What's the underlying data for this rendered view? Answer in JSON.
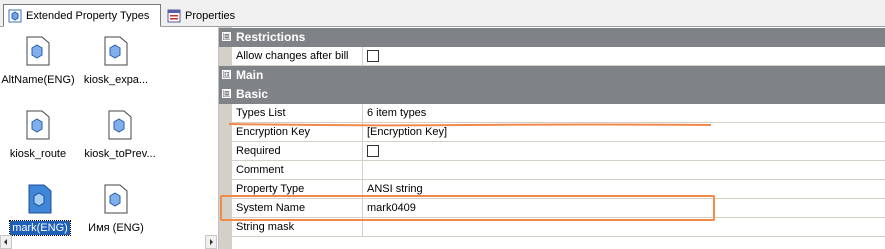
{
  "tabs": [
    {
      "label": "Extended Property Types",
      "icon": "property-type-icon",
      "active": true
    },
    {
      "label": "Properties",
      "icon": "properties-icon",
      "active": false
    }
  ],
  "left_items": [
    {
      "label": "AltName(ENG)",
      "icon": "hexagon-doc-icon"
    },
    {
      "label": "kiosk_expa...",
      "icon": "hexagon-doc-icon"
    },
    {
      "label": "kiosk_route",
      "icon": "hexagon-doc-icon"
    },
    {
      "label": "kiosk_toPrev...",
      "icon": "hexagon-doc-icon"
    },
    {
      "label": "mark(ENG)",
      "icon": "hexagon-doc-icon",
      "selected": true
    },
    {
      "label": "Имя (ENG)",
      "icon": "hexagon-doc-icon"
    }
  ],
  "grid": {
    "categories": {
      "restrictions": {
        "label": "Restrictions",
        "toggle": "⊟"
      },
      "main": {
        "label": "Main",
        "toggle": "⊞"
      },
      "basic": {
        "label": "Basic",
        "toggle": "⊟"
      }
    },
    "rows": {
      "allow_changes": {
        "name": "Allow changes after bill",
        "value": "",
        "checkbox": true
      },
      "types_list": {
        "name": "Types List",
        "value": "6 item types"
      },
      "encryption_key": {
        "name": "Encryption Key",
        "value": "[Encryption Key]"
      },
      "required": {
        "name": "Required",
        "value": "",
        "checkbox": true
      },
      "comment": {
        "name": "Comment",
        "value": ""
      },
      "property_type": {
        "name": "Property Type",
        "value": "ANSI string"
      },
      "system_name": {
        "name": "System Name",
        "value": "mark0409"
      },
      "string_mask": {
        "name": "String mask",
        "value": ""
      }
    }
  },
  "colors": {
    "category_bg": "#7f8286",
    "annotation": "#f08a4b",
    "selection": "#1f5fb8"
  }
}
